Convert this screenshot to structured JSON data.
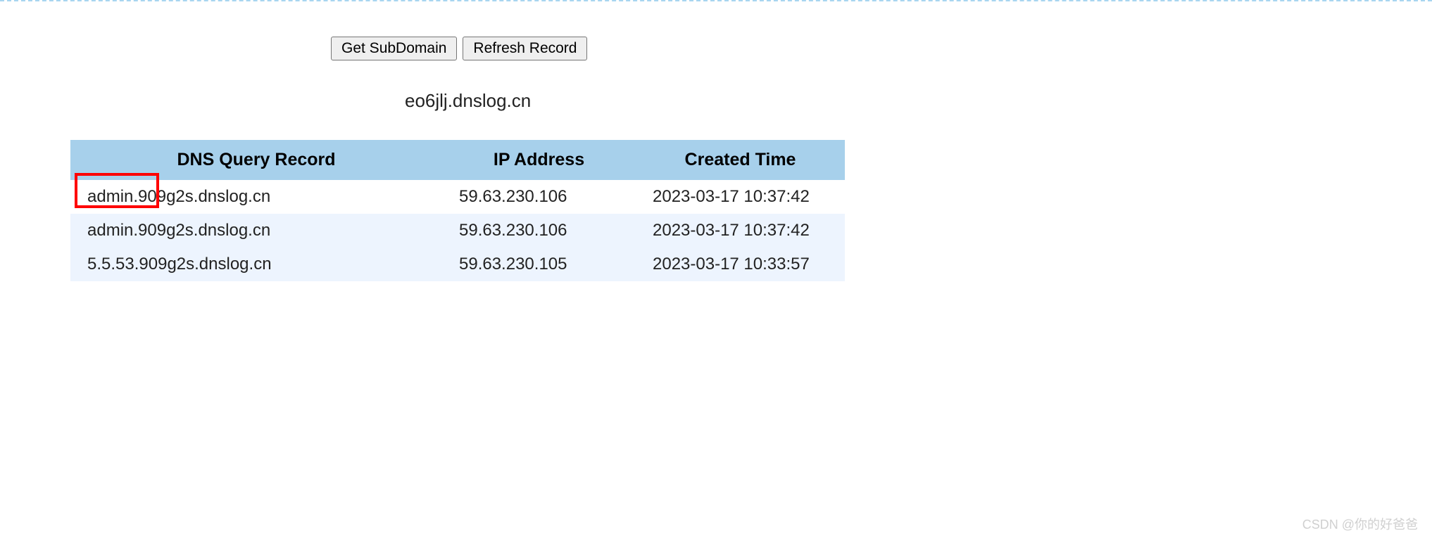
{
  "buttons": {
    "get_subdomain": "Get SubDomain",
    "refresh_record": "Refresh Record"
  },
  "subdomain": "eo6jlj.dnslog.cn",
  "table": {
    "headers": {
      "record": "DNS Query Record",
      "ip": "IP Address",
      "time": "Created Time"
    },
    "rows": [
      {
        "record": "admin.909g2s.dnslog.cn",
        "ip": "59.63.230.106",
        "time": "2023-03-17 10:37:42"
      },
      {
        "record": "admin.909g2s.dnslog.cn",
        "ip": "59.63.230.106",
        "time": "2023-03-17 10:37:42"
      },
      {
        "record": "5.5.53.909g2s.dnslog.cn",
        "ip": "59.63.230.105",
        "time": "2023-03-17 10:33:57"
      }
    ]
  },
  "watermark": "CSDN @你的好爸爸"
}
